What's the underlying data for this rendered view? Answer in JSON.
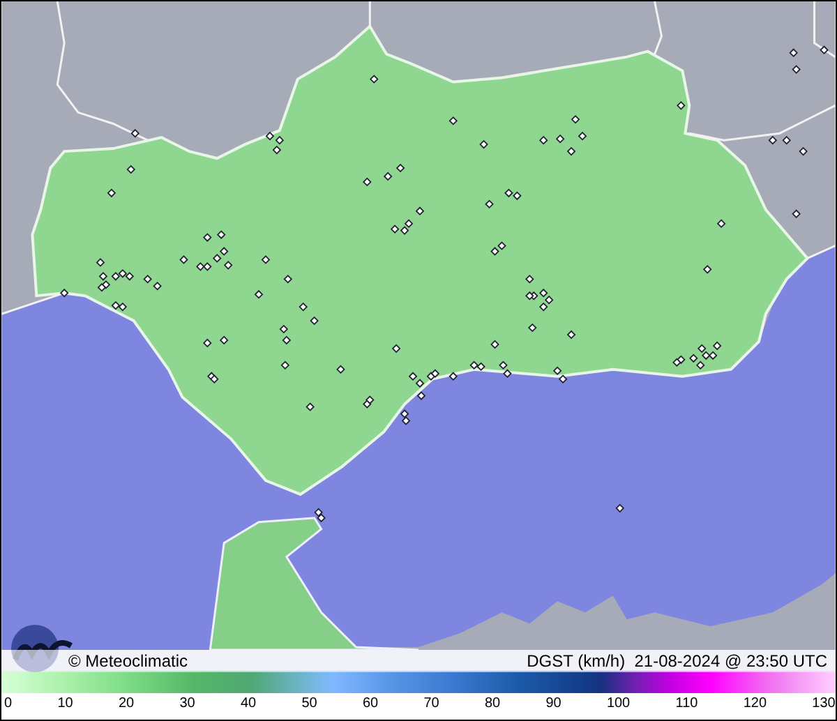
{
  "credit": "© Meteoclimatic",
  "caption": "DGST (km/h)  21-08-2024 @ 23:50 UTC",
  "scale": {
    "ticks": [
      "0",
      "10",
      "20",
      "30",
      "40",
      "50",
      "60",
      "70",
      "80",
      "90",
      "100",
      "110",
      "120",
      "130"
    ]
  }
}
